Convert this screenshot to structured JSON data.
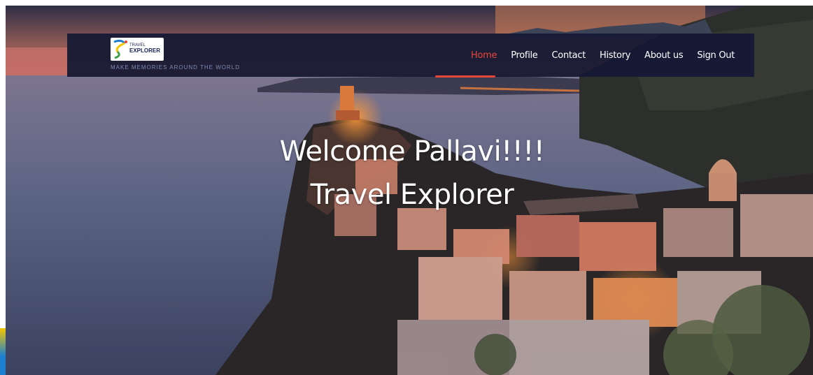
{
  "brand": {
    "logo_line1": "TRAVEL",
    "logo_line2": "EXPLORER",
    "tagline": "MAKE MEMORIES AROUND THE WORLD"
  },
  "nav": {
    "items": [
      {
        "label": "Home",
        "active": true
      },
      {
        "label": "Profile",
        "active": false
      },
      {
        "label": "Contact",
        "active": false
      },
      {
        "label": "History",
        "active": false
      },
      {
        "label": "About us",
        "active": false
      },
      {
        "label": "Sign Out",
        "active": false
      }
    ],
    "active_color": "#e8463b"
  },
  "hero": {
    "welcome_line": "Welcome Pallavi!!!!",
    "title_line": "Travel Explorer"
  },
  "colors": {
    "navbar_bg": "#141834",
    "text": "#ffffff",
    "accent": "#e8463b"
  }
}
